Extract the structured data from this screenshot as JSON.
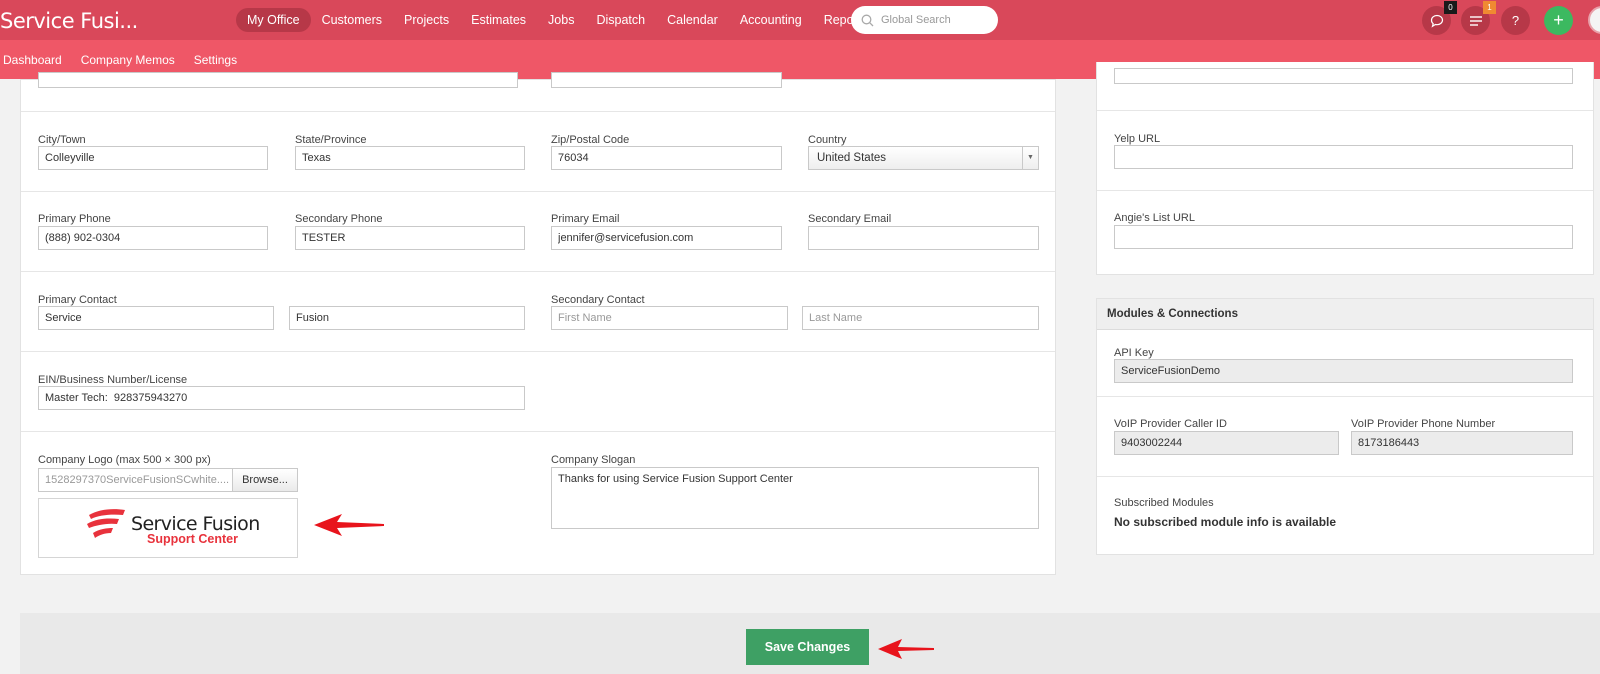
{
  "app": {
    "title": "Service Fusi..."
  },
  "nav": {
    "items": [
      {
        "label": "My Office",
        "active": true
      },
      {
        "label": "Customers"
      },
      {
        "label": "Projects"
      },
      {
        "label": "Estimates"
      },
      {
        "label": "Jobs"
      },
      {
        "label": "Dispatch"
      },
      {
        "label": "Calendar"
      },
      {
        "label": "Accounting"
      },
      {
        "label": "Reports"
      }
    ]
  },
  "search": {
    "placeholder": "Global Search"
  },
  "header_icons": {
    "chat": {
      "icon": "chat-bubble-icon",
      "badge": "0",
      "badge_color": "#1a1a1a"
    },
    "notifications": {
      "icon": "list-icon",
      "badge": "1",
      "badge_color": "#f08a32"
    },
    "help": {
      "icon": "question-icon",
      "label": "?"
    },
    "add": {
      "icon": "plus-icon",
      "label": "+"
    }
  },
  "subnav": {
    "items": [
      "Dashboard",
      "Company Memos",
      "Settings"
    ]
  },
  "form": {
    "city": {
      "label": "City/Town",
      "value": "Colleyville"
    },
    "state": {
      "label": "State/Province",
      "value": "Texas"
    },
    "zip": {
      "label": "Zip/Postal Code",
      "value": "76034"
    },
    "country": {
      "label": "Country",
      "value": "United States"
    },
    "primary_phone": {
      "label": "Primary Phone",
      "value": "(888) 902-0304"
    },
    "secondary_phone": {
      "label": "Secondary Phone",
      "value": "TESTER"
    },
    "primary_email": {
      "label": "Primary Email",
      "value": "jennifer@servicefusion.com"
    },
    "secondary_email": {
      "label": "Secondary Email",
      "value": ""
    },
    "primary_contact": {
      "label": "Primary Contact",
      "first": "Service",
      "last": "Fusion"
    },
    "secondary_contact": {
      "label": "Secondary Contact",
      "first_placeholder": "First Name",
      "last_placeholder": "Last Name"
    },
    "ein": {
      "label": "EIN/Business Number/License",
      "value": "Master Tech:  928375943270"
    },
    "logo": {
      "label": "Company Logo (max 500 × 300 px)",
      "filename": "1528297370ServiceFusionSCwhite....",
      "browse_label": "Browse...",
      "logo_line1": "Service Fusion",
      "logo_line2": "Support Center"
    },
    "slogan": {
      "label": "Company Slogan",
      "value": "Thanks for using Service Fusion Support Center"
    }
  },
  "social": {
    "yelp": {
      "label": "Yelp URL",
      "value": ""
    },
    "angies": {
      "label": "Angie's List URL",
      "value": ""
    }
  },
  "modules": {
    "title": "Modules & Connections",
    "api_key": {
      "label": "API Key",
      "value": "ServiceFusionDemo"
    },
    "voip_caller": {
      "label": "VoIP Provider Caller ID",
      "value": "9403002244"
    },
    "voip_phone": {
      "label": "VoIP Provider Phone Number",
      "value": "8173186443"
    },
    "subscribed": {
      "label": "Subscribed Modules",
      "value": "No subscribed module info is available"
    }
  },
  "actions": {
    "save_label": "Save Changes"
  },
  "colors": {
    "topbar": "#d9485a",
    "subbar": "#ef5767",
    "save": "#3ea064",
    "annotation_arrow": "#e8141c"
  }
}
